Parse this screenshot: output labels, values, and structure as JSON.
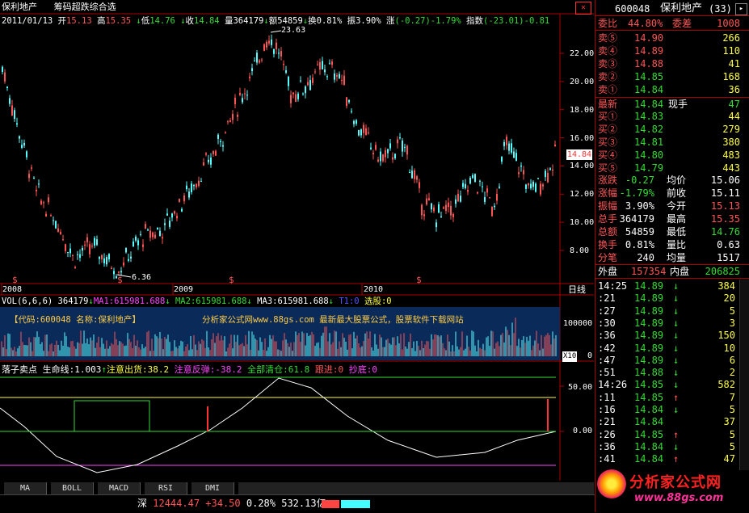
{
  "header": {
    "stock_name": "保利地产",
    "indicator_name": "筹码超跌综合选",
    "date": "2011/01/13",
    "open_label": "开",
    "open": "15.13",
    "high_label": "高",
    "high": "15.35",
    "low_label": "低",
    "low": "14.76",
    "close_label": "收",
    "close": "14.84",
    "vol_label": "量",
    "vol": "364179",
    "amount_label": "额",
    "amount": "54859",
    "turnover_label": "换",
    "turnover": "0.81%",
    "amplitude_label": "振",
    "amplitude": "3.90%",
    "change_label": "涨",
    "change": "(-0.27)-1.79%",
    "index_label": "指数",
    "index": "(-23.01)-0.81"
  },
  "price_axis": {
    "ticks": [
      "22.00",
      "20.00",
      "18.00",
      "16.00",
      "14.00",
      "12.00",
      "10.00",
      "8.00"
    ],
    "current_price_tag": "14.84"
  },
  "annotations": {
    "high_marker": "23.63",
    "low_marker": "6.36",
    "signal_mark": "$"
  },
  "time_axis": {
    "labels": [
      "2008",
      "2009",
      "2010"
    ],
    "period_label": "日线"
  },
  "volume": {
    "title": "VOL(6,6,6)",
    "value": "364179",
    "ma1": "MA1:615981.688",
    "ma2": "MA2:615981.688",
    "ma3": "MA3:615981.688",
    "t1": "T1:0",
    "xuangu": "选股:0",
    "banner_left": "【代码:600048 名称:保利地产】",
    "banner_right": "分析家公式网www.88gs.com  最新最大股票公式，股票软件下载网站",
    "ticks": [
      "100000",
      "0"
    ],
    "unit": "X10"
  },
  "indicator": {
    "title": "落子卖点",
    "lifeline": "生命线:1.003",
    "attention": "注意出货:38.2",
    "rebound": "注意反弹:-38.2",
    "clear": "全部清仓:61.8",
    "follow": "跟进:0",
    "bottom": "抄底:0",
    "ticks": [
      "50.00",
      "0.00"
    ]
  },
  "tabs": [
    "MA",
    "BOLL",
    "MACD",
    "RSI",
    "DMI"
  ],
  "status": {
    "market": "深",
    "index": "12444.47",
    "change": "+34.50",
    "pct": "0.28%",
    "amount": "532.13亿"
  },
  "quote": {
    "code": "600048",
    "name": "保利地产",
    "num": "(33)",
    "webi_label": "委比",
    "webi": "44.80%",
    "weicha_label": "委差",
    "weicha": "1008",
    "sell": [
      {
        "label": "卖⑤",
        "price": "14.90",
        "vol": "266"
      },
      {
        "label": "卖④",
        "price": "14.89",
        "vol": "110"
      },
      {
        "label": "卖③",
        "price": "14.88",
        "vol": "41"
      },
      {
        "label": "卖②",
        "price": "14.85",
        "vol": "168"
      },
      {
        "label": "卖①",
        "price": "14.84",
        "vol": "36"
      }
    ],
    "latest_label": "最新",
    "latest": "14.84",
    "xianshou_label": "现手",
    "xianshou": "47",
    "buy": [
      {
        "label": "买①",
        "price": "14.83",
        "vol": "44"
      },
      {
        "label": "买②",
        "price": "14.82",
        "vol": "279"
      },
      {
        "label": "买③",
        "price": "14.81",
        "vol": "380"
      },
      {
        "label": "买④",
        "price": "14.80",
        "vol": "483"
      },
      {
        "label": "买⑤",
        "price": "14.79",
        "vol": "443"
      }
    ],
    "stats": [
      {
        "l1": "涨跌",
        "v1": "-0.27",
        "l2": "均价",
        "v2": "15.06",
        "c1": "#33dd33",
        "c2": "#ffffff"
      },
      {
        "l1": "涨幅",
        "v1": "-1.79%",
        "l2": "前收",
        "v2": "15.11",
        "c1": "#33dd33",
        "c2": "#ffffff"
      },
      {
        "l1": "振幅",
        "v1": "3.90%",
        "l2": "今开",
        "v2": "15.13",
        "c1": "#ffffff",
        "c2": "#ff5555"
      },
      {
        "l1": "总手",
        "v1": "364179",
        "l2": "最高",
        "v2": "15.35",
        "c1": "#ffffff",
        "c2": "#ff5555"
      },
      {
        "l1": "总额",
        "v1": "54859",
        "l2": "最低",
        "v2": "14.76",
        "c1": "#ffffff",
        "c2": "#33dd33"
      },
      {
        "l1": "换手",
        "v1": "0.81%",
        "l2": "量比",
        "v2": "0.63",
        "c1": "#ffffff",
        "c2": "#ffffff"
      },
      {
        "l1": "分笔",
        "v1": "240",
        "l2": "均量",
        "v2": "1517",
        "c1": "#ffffff",
        "c2": "#ffffff"
      }
    ],
    "waipan_label": "外盘",
    "waipan": "157354",
    "neipan_label": "内盘",
    "neipan": "206825",
    "ticks": [
      {
        "t": "14:25",
        "p": "14.89",
        "a": "↓",
        "v": "384",
        "c": "#33dd33"
      },
      {
        "t": ":21",
        "p": "14.89",
        "a": "↓",
        "v": "20",
        "c": "#33dd33"
      },
      {
        "t": ":27",
        "p": "14.89",
        "a": "↓",
        "v": "5",
        "c": "#33dd33"
      },
      {
        "t": ":30",
        "p": "14.89",
        "a": "↓",
        "v": "3",
        "c": "#33dd33"
      },
      {
        "t": ":36",
        "p": "14.89",
        "a": "↓",
        "v": "150",
        "c": "#33dd33"
      },
      {
        "t": ":42",
        "p": "14.89",
        "a": "↓",
        "v": "10",
        "c": "#33dd33"
      },
      {
        "t": ":47",
        "p": "14.89",
        "a": "↓",
        "v": "6",
        "c": "#33dd33"
      },
      {
        "t": ":51",
        "p": "14.88",
        "a": "↓",
        "v": "2",
        "c": "#33dd33"
      },
      {
        "t": "14:26",
        "p": "14.85",
        "a": "↓",
        "v": "582",
        "c": "#33dd33"
      },
      {
        "t": ":11",
        "p": "14.85",
        "a": "↑",
        "v": "7",
        "c": "#ff5555"
      },
      {
        "t": ":16",
        "p": "14.84",
        "a": "↓",
        "v": "5",
        "c": "#33dd33"
      },
      {
        "t": ":21",
        "p": "14.84",
        "a": "",
        "v": "37",
        "c": "#33dd33"
      },
      {
        "t": ":26",
        "p": "14.85",
        "a": "↑",
        "v": "5",
        "c": "#ff5555"
      },
      {
        "t": ":36",
        "p": "14.84",
        "a": "↓",
        "v": "5",
        "c": "#33dd33"
      },
      {
        "t": ":41",
        "p": "14.84",
        "a": "↑",
        "v": "47",
        "c": "#ff5555"
      }
    ]
  },
  "logo": {
    "text": "分析家公式网",
    "url": "www.88gs.com"
  }
}
